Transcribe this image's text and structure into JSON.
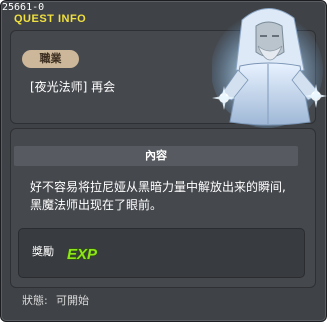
{
  "header": {
    "quest_id": "25661-0",
    "section_label": "QUEST INFO"
  },
  "job": {
    "badge_label": "職業",
    "value": "[夜光法师]  再会"
  },
  "content": {
    "header_label": "內容",
    "line1": "好不容易将拉尼娅从黑暗力量中解放出来的瞬间,",
    "line2": "黑魔法师出现在了眼前。"
  },
  "reward": {
    "label": "獎勵",
    "icon_name": "exp-icon",
    "icon_text": "EXP"
  },
  "status": {
    "label": "狀態:",
    "value": "可開始"
  },
  "colors": {
    "frame": "#3f4246",
    "accent_yellow": "#f0e040",
    "badge": "#cdb79a",
    "exp_green": "#8fe61a"
  }
}
